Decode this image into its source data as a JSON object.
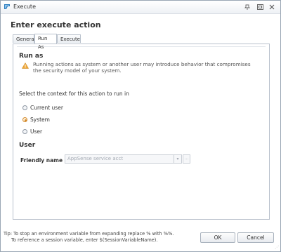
{
  "window": {
    "title": "Execute",
    "buttons": [
      "pin-icon",
      "restore-icon",
      "close-icon"
    ]
  },
  "heading": "Enter execute action",
  "tabs": [
    {
      "label": "General",
      "active": false
    },
    {
      "label": "Run As",
      "active": true
    },
    {
      "label": "Execute",
      "active": false
    }
  ],
  "run_as": {
    "title": "Run as",
    "warning_icon": "warning-icon",
    "warning_text": "Running actions as system or another user may introduce behavior that compromises the security model of your system.",
    "context_label": "Select the context for this action to run in",
    "options": [
      {
        "label": "Current user",
        "checked": false
      },
      {
        "label": "System",
        "checked": true
      },
      {
        "label": "User",
        "checked": false
      }
    ]
  },
  "user": {
    "title": "User",
    "friendly_name_label": "Friendly name",
    "friendly_name_value": "AppSense service acct",
    "drop_glyph": "▾",
    "more_glyph": "..."
  },
  "footer": {
    "tip_line1": "Tip: To stop an environment variable from expanding replace % with %%.",
    "tip_line2": "To reference a session variable, enter $(SessionVariableName).",
    "ok_label": "OK",
    "cancel_label": "Cancel"
  },
  "colors": {
    "accent": "#d38a2c",
    "border": "#b9c1cc"
  }
}
